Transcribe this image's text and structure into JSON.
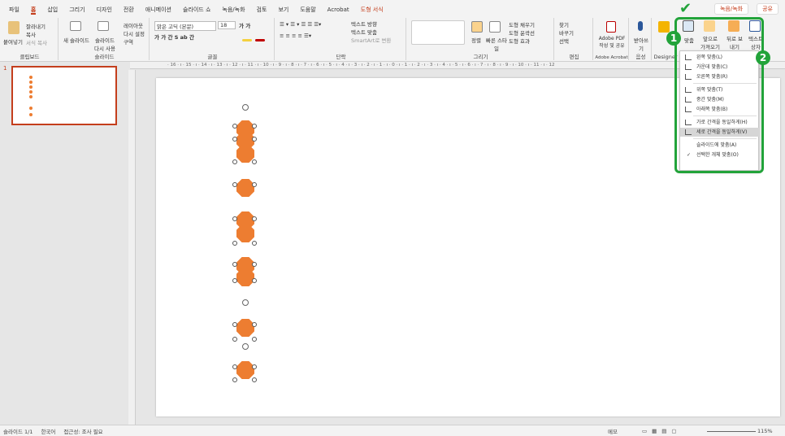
{
  "tabs": [
    "파일",
    "홈",
    "삽입",
    "그리기",
    "디자인",
    "전환",
    "애니메이션",
    "슬라이드 쇼",
    "녹음/녹화",
    "검토",
    "보기",
    "도움말",
    "Acrobat",
    "도형 서식"
  ],
  "top_right": {
    "record": "녹음/녹화",
    "share": "공유"
  },
  "ribbon": {
    "clipboard": {
      "paste": "붙여넣기",
      "cut": "잘라내기",
      "copy": "복사",
      "format": "서식 복사",
      "label": "클립보드"
    },
    "slides": {
      "new": "새 슬라이드",
      "reuse": "슬라이드 다시 사용",
      "layout": "레이아웃",
      "reset": "다시 설정",
      "section": "구역",
      "label": "슬라이드"
    },
    "font": {
      "name": "맑은 고딕 (본문)",
      "size": "18",
      "label": "글꼴"
    },
    "paragraph": {
      "dir": "텍스트 방향",
      "align": "텍스트 맞춤",
      "smartart": "SmartArt로 변환",
      "label": "단락"
    },
    "drawing": {
      "arrange": "정렬",
      "quick": "빠른 스타일",
      "fill": "도형 채우기",
      "outline": "도형 윤곽선",
      "effect": "도형 효과",
      "label": "그리기"
    },
    "editing": {
      "find": "찾기",
      "replace": "바꾸기",
      "select": "선택",
      "label": "편집"
    },
    "acrobat": {
      "create": "Adobe PDF 작성 및 공유",
      "label": "Adobe Acrobat"
    },
    "voice": {
      "dictate": "받아쓰기",
      "label": "음성"
    },
    "designer": {
      "label": "Designer"
    },
    "arrange2": {
      "align": "맞춤",
      "front": "앞으로 가져오기",
      "back": "뒤로 보내기",
      "textbox": "텍스트 상자"
    }
  },
  "ruler_text": "· 16 · ı · 15 · ı · 14 · ı · 13 · ı · 12 · ı · 11 · ı · 10 · ı · 9 · ı · 8 · ı · 7 · ı · 6 · ı · 5 · ı · 4 · ı · 3 · ı · 2 · ı · 1 · ı · 0 · ı · 1 · ı · 2 · ı · 3 · ı · 4 · ı · 5 · ı · 6 · ı · 7 · ı · 8 · ı · 9 · ı · 10 · ı · 11 · ı · 12",
  "slide_number": "1",
  "menu": {
    "items": [
      "왼쪽 맞춤(L)",
      "가운데 맞춤(C)",
      "오른쪽 맞춤(R)",
      "위쪽 맞춤(T)",
      "중간 맞춤(M)",
      "아래쪽 맞춤(B)",
      "가로 간격을 동일하게(H)",
      "세로 간격을 동일하게(V)",
      "슬라이드에 맞춤(A)",
      "선택한 개체 맞춤(O)"
    ],
    "highlighted_index": 7,
    "checked_index": 9
  },
  "annotations": {
    "step1": "1",
    "step2": "2"
  },
  "status": {
    "slide": "슬라이드 1/1",
    "lang": "한국어",
    "access": "접근성: 조사 필요",
    "notes": "메모",
    "zoom": "115%"
  },
  "colors": {
    "accent": "#c43e1c",
    "shape": "#ed7d31",
    "highlight": "#22a33a"
  }
}
